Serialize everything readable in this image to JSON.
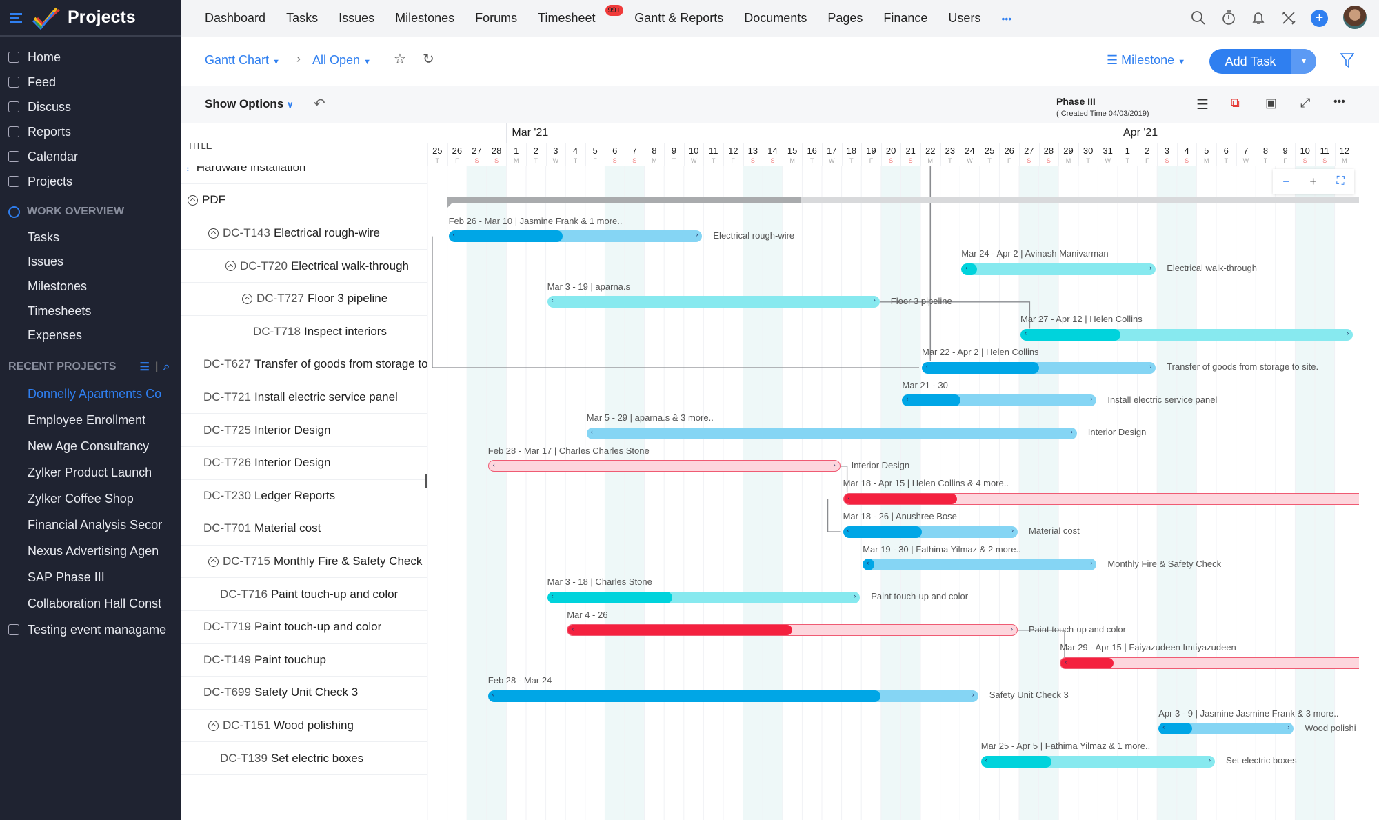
{
  "app": {
    "title": "Projects"
  },
  "sidebar": {
    "main": [
      {
        "label": "Home",
        "icon": "home-icon"
      },
      {
        "label": "Feed",
        "icon": "feed-icon"
      },
      {
        "label": "Discuss",
        "icon": "discuss-icon"
      },
      {
        "label": "Reports",
        "icon": "reports-icon"
      },
      {
        "label": "Calendar",
        "icon": "calendar-icon"
      },
      {
        "label": "Projects",
        "icon": "projects-icon"
      }
    ],
    "work_overview": {
      "title": "WORK OVERVIEW",
      "items": [
        "Tasks",
        "Issues",
        "Milestones",
        "Timesheets",
        "Expenses"
      ]
    },
    "recent": {
      "title": "RECENT PROJECTS",
      "items": [
        "Donnelly Apartments Co",
        "Employee Enrollment",
        "New Age Consultancy",
        "Zylker Product Launch",
        "Zylker Coffee Shop",
        "Financial Analysis Secon",
        "Nexus Advertising Agen",
        "SAP Phase III",
        "Collaboration Hall Const"
      ],
      "active": 0
    },
    "testing": "Testing event managame"
  },
  "topnav": {
    "items": [
      "Dashboard",
      "Tasks",
      "Issues",
      "Milestones",
      "Forums",
      "Timesheet",
      "Gantt & Reports",
      "Documents",
      "Pages",
      "Finance",
      "Users"
    ],
    "active": "Gantt & Reports",
    "timesheet_badge": "99+",
    "more": "•••"
  },
  "crumbs": {
    "view": "Gantt Chart",
    "filter": "All Open",
    "group": "Milestone",
    "add_task": "Add Task"
  },
  "options": {
    "show_options": "Show Options",
    "milestone_name": "Phase III",
    "created": "( Created Time 04/03/2019)",
    "more": "•••"
  },
  "gantt": {
    "title_header": "TITLE",
    "start": "2021-02-25",
    "months": [
      {
        "label": "Mar '21",
        "day": 4
      },
      {
        "label": "Apr '21",
        "day": 35
      }
    ],
    "days": [
      "25",
      "26",
      "27",
      "28",
      "1",
      "2",
      "3",
      "4",
      "5",
      "6",
      "7",
      "8",
      "9",
      "10",
      "11",
      "12",
      "13",
      "14",
      "15",
      "16",
      "17",
      "18",
      "19",
      "20",
      "21",
      "22",
      "23",
      "24",
      "25",
      "26",
      "27",
      "28",
      "29",
      "30",
      "31",
      "1",
      "2",
      "3",
      "4",
      "5",
      "6",
      "7",
      "8",
      "9",
      "10",
      "11",
      "12"
    ],
    "weekdays": [
      "T",
      "F",
      "S",
      "S",
      "M",
      "T",
      "W"
    ],
    "today": "2021-03-22",
    "hardware_row": "Hardware installation",
    "milestone": {
      "name": "PDF",
      "start": "2021-02-26",
      "end": "2021-04-30",
      "progress": 28
    },
    "colors": {
      "blue": [
        "#00a6e6",
        "#85d5f4"
      ],
      "teal": [
        "#00d3dc",
        "#87e9ef"
      ],
      "red": [
        "#f4213f",
        "#fdd6dd"
      ]
    },
    "tasks": [
      {
        "id": "DC-T143",
        "name": "Electrical rough-wire",
        "indent": 1,
        "tog": true,
        "start": "2021-02-26",
        "end": "2021-03-10",
        "progress": 45,
        "color": "blue",
        "info": "Feb 26 - Mar 10 | Jasmine Frank & 1 more..",
        "right": "Electrical rough-wire"
      },
      {
        "id": "DC-T720",
        "name": "Electrical walk-through",
        "indent": 2,
        "tog": true,
        "start": "2021-03-24",
        "end": "2021-04-02",
        "progress": 8,
        "color": "teal",
        "info": "Mar 24 - Apr 2 | Avinash Manivarman",
        "right": "Electrical walk-through"
      },
      {
        "id": "DC-T727",
        "name": "Floor 3 pipeline",
        "indent": 3,
        "tog": true,
        "start": "2021-03-03",
        "end": "2021-03-19",
        "progress": 0,
        "color": "teal",
        "info": "Mar 3 - 19 | aparna.s",
        "right": "Floor 3 pipeline"
      },
      {
        "id": "DC-T718",
        "name": "Inspect interiors",
        "indent": 4,
        "tog": false,
        "start": "2021-03-27",
        "end": "2021-04-12",
        "progress": 30,
        "color": "teal",
        "info": "Mar 27 - Apr 12 | Helen Collins",
        "right": ""
      },
      {
        "id": "DC-T627",
        "name": "Transfer of goods from storage to",
        "indent": 0,
        "tog": false,
        "start": "2021-03-22",
        "end": "2021-04-02",
        "progress": 50,
        "color": "blue",
        "info": "Mar 22 - Apr 2 | Helen Collins",
        "right": "Transfer of goods from storage to site."
      },
      {
        "id": "DC-T721",
        "name": "Install electric service panel",
        "indent": 0,
        "tog": false,
        "start": "2021-03-21",
        "end": "2021-03-30",
        "progress": 30,
        "color": "blue",
        "info": "Mar 21 - 30",
        "right": "Install electric service panel"
      },
      {
        "id": "DC-T725",
        "name": "Interior Design",
        "indent": 0,
        "tog": false,
        "start": "2021-03-05",
        "end": "2021-03-29",
        "progress": 0,
        "color": "blue",
        "info": "Mar 5 - 29 | aparna.s & 3 more..",
        "right": "Interior Design"
      },
      {
        "id": "DC-T726",
        "name": "Interior Design",
        "indent": 0,
        "tog": false,
        "start": "2021-02-28",
        "end": "2021-03-17",
        "progress": 0,
        "color": "red",
        "info": "Feb 28 - Mar 17 | Charles Charles Stone",
        "right": "Interior Design"
      },
      {
        "id": "DC-T230",
        "name": "Ledger Reports",
        "indent": 0,
        "tog": false,
        "start": "2021-03-18",
        "end": "2021-04-15",
        "progress": 20,
        "color": "red",
        "info": "Mar 18 - Apr 15 | Helen Collins & 4 more..",
        "right": ""
      },
      {
        "id": "DC-T701",
        "name": "Material cost",
        "indent": 0,
        "tog": false,
        "start": "2021-03-18",
        "end": "2021-03-26",
        "progress": 45,
        "color": "blue",
        "info": "Mar 18 - 26 | Anushree Bose",
        "right": "Material cost"
      },
      {
        "id": "DC-T715",
        "name": "Monthly Fire & Safety Check",
        "indent": 1,
        "tog": true,
        "start": "2021-03-19",
        "end": "2021-03-30",
        "progress": 5,
        "color": "blue",
        "info": "Mar 19 - 30 | Fathima Yilmaz & 2 more..",
        "right": "Monthly Fire & Safety Check"
      },
      {
        "id": "DC-T716",
        "name": "Paint touch-up and color",
        "indent": 2,
        "tog": false,
        "start": "2021-03-03",
        "end": "2021-03-18",
        "progress": 40,
        "color": "teal",
        "info": "Mar 3 - 18 | Charles Stone",
        "right": "Paint touch-up and color"
      },
      {
        "id": "DC-T719",
        "name": "Paint touch-up and color",
        "indent": 0,
        "tog": false,
        "start": "2021-03-04",
        "end": "2021-03-26",
        "progress": 50,
        "color": "red",
        "info": "Mar 4 - 26",
        "right": "Paint touch-up and color"
      },
      {
        "id": "DC-T149",
        "name": "Paint touchup",
        "indent": 0,
        "tog": false,
        "start": "2021-03-29",
        "end": "2021-04-15",
        "progress": 15,
        "color": "red",
        "info": "Mar 29 - Apr 15 | Faiyazudeen Imtiyazudeen",
        "right": ""
      },
      {
        "id": "DC-T699",
        "name": "Safety Unit Check 3",
        "indent": 0,
        "tog": false,
        "start": "2021-02-28",
        "end": "2021-03-24",
        "progress": 80,
        "color": "blue",
        "info": "Feb 28 - Mar 24",
        "right": "Safety Unit Check 3"
      },
      {
        "id": "DC-T151",
        "name": "Wood polishing",
        "indent": 1,
        "tog": true,
        "start": "2021-04-03",
        "end": "2021-04-09",
        "progress": 25,
        "color": "blue",
        "info": "Apr 3 - 9 | Jasmine Jasmine Frank & 3 more..",
        "right": "Wood polishi"
      },
      {
        "id": "DC-T139",
        "name": "Set electric boxes",
        "indent": 2,
        "tog": false,
        "start": "2021-03-25",
        "end": "2021-04-05",
        "progress": 30,
        "color": "teal",
        "info": "Mar 25 - Apr 5 | Fathima Yilmaz & 1 more..",
        "right": "Set electric boxes"
      }
    ]
  }
}
